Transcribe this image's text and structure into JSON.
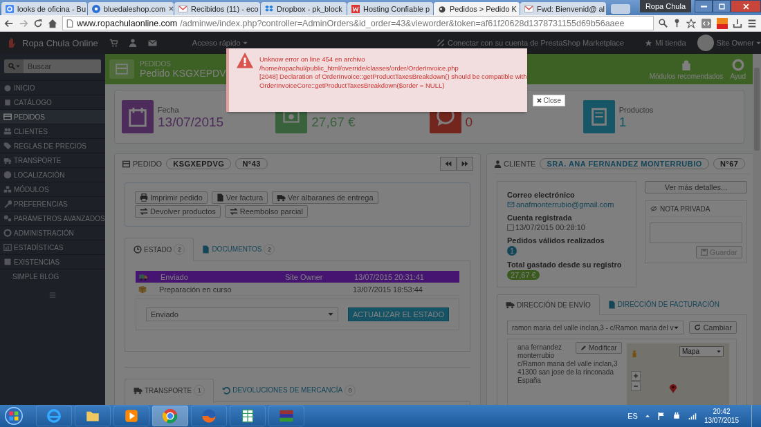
{
  "browser": {
    "tabs": [
      {
        "title": "looks de oficina - Bu",
        "kind": "google",
        "selected": false
      },
      {
        "title": "bluedaleshop.com",
        "kind": "a",
        "selected": false
      },
      {
        "title": "Recibidos (11) - eco",
        "kind": "mail",
        "selected": false
      },
      {
        "title": "Dropbox - pk_block",
        "kind": "dropbox",
        "selected": false
      },
      {
        "title": "Hosting Confiable p",
        "kind": "hosting",
        "selected": false
      },
      {
        "title": "Pedidos > Pedido K",
        "kind": "shop",
        "selected": true
      },
      {
        "title": "Fwd: Bienvenid@ al",
        "kind": "mail",
        "selected": false
      }
    ],
    "profile": "Ropa Chula",
    "url_host": "www.ropachulaonline.com",
    "url_path": "/adminwe/index.php?controller=AdminOrders&id_order=43&vieworder&token=af61f20628d1378731155d69b56aaee"
  },
  "admin_header": {
    "shop_name": "Ropa Chula Online",
    "quick_access": "Acceso rápido",
    "marketplace": "Conectar con su cuenta de PrestaShop Marketplace",
    "my_shop": "Mi tienda",
    "user": "Site Owner"
  },
  "sidebar": {
    "search_placeholder": "Buscar",
    "items": [
      {
        "label": "INICIO",
        "selected": false
      },
      {
        "label": "CATÁLOGO",
        "selected": false
      },
      {
        "label": "PEDIDOS",
        "selected": true
      },
      {
        "label": "CLIENTES",
        "selected": false
      },
      {
        "label": "REGLAS DE PRECIOS",
        "selected": false
      },
      {
        "label": "TRANSPORTE",
        "selected": false
      },
      {
        "label": "LOCALIZACIÓN",
        "selected": false
      },
      {
        "label": "MÓDULOS",
        "selected": false
      },
      {
        "label": "PREFERENCIAS",
        "selected": false
      },
      {
        "label": "PARÁMETROS AVANZADOS",
        "selected": false
      },
      {
        "label": "ADMINISTRACIÓN",
        "selected": false
      },
      {
        "label": "ESTADÍSTICAS",
        "selected": false
      },
      {
        "label": "EXISTENCIAS",
        "selected": false
      },
      {
        "label": "SIMPLE BLOG",
        "selected": false
      }
    ]
  },
  "page_header": {
    "breadcrumb": "PEDIDOS",
    "title": "Pedido KSGXEPDV",
    "toolbar": [
      "Módulos recomendados",
      "Ayud"
    ]
  },
  "kpis": [
    {
      "kind": "date",
      "label": "Fecha",
      "value": "13/07/2015"
    },
    {
      "kind": "money",
      "value": "27,67 €"
    },
    {
      "kind": "messages",
      "value": "0"
    },
    {
      "kind": "products",
      "label": "Productos",
      "value": "1"
    }
  ],
  "order": {
    "heading": "PEDIDO",
    "reference": "KSGXEPDVG",
    "number": "N°43",
    "actions": [
      {
        "label": "Imprimir pedido",
        "kind": "print"
      },
      {
        "label": "Ver factura",
        "kind": "file"
      },
      {
        "label": "Ver albaranes de entrega",
        "kind": "truck"
      },
      {
        "label": "Devolver productos",
        "kind": "exchange"
      },
      {
        "label": "Reembolso parcial",
        "kind": "exchange"
      }
    ],
    "tabs": [
      {
        "label": "ESTADO",
        "count": "2",
        "kind": "clock",
        "selected": true
      },
      {
        "label": "DOCUMENTOS",
        "count": "2",
        "kind": "file",
        "selected": false
      }
    ],
    "history": [
      {
        "kind": "shipped",
        "status": "Enviado",
        "employee": "Site Owner",
        "date": "13/07/2015 20:31:41",
        "highlighted": true
      },
      {
        "kind": "preparing",
        "status": "Preparación en curso",
        "date": "13/07/2015 18:53:44",
        "highlighted": false
      }
    ],
    "status_select": "Enviado",
    "update_button": "ACTUALIZAR EL ESTADO",
    "lower_tabs": [
      {
        "label": "TRANSPORTE",
        "count": "1",
        "kind": "truck",
        "selected": true
      },
      {
        "label": "DEVOLUCIONES DE MERCANCÍA",
        "count": "0",
        "kind": "undo",
        "selected": false
      }
    ]
  },
  "customer": {
    "heading": "CLIENTE",
    "name": "SRA. ANA FERNANDEZ MONTERRUBIO",
    "number": "N°67",
    "email_label": "Correo electrónico",
    "email": "anafmonterrubio@gmail.com",
    "registered_label": "Cuenta registrada",
    "registered": "13/07/2015 00:28:10",
    "orders_label": "Pedidos válidos realizados",
    "orders": "1",
    "total_label": "Total gastado desde su registro",
    "total": "27,67 €",
    "details_button": "Ver más detalles...",
    "note_heading": "NOTA PRIVADA",
    "save_button": "Guardar",
    "address_tabs": [
      {
        "label": "DIRECCIÓN DE ENVÍO",
        "kind": "truck",
        "selected": true
      },
      {
        "label": "DIRECCIÓN DE FACTURACIÓN",
        "kind": "file",
        "selected": false
      }
    ],
    "address_select": "ramon maria del valle inclan,3 - c/Ramon maria del v",
    "change_button": "Cambiar",
    "address_lines": [
      "ana fernandez",
      "monterrubio",
      "c/Ramon maria del valle inclan,3",
      "41300 san jose de la rinconada",
      "España"
    ],
    "edit_button": "Modificar",
    "map_type": "Mapa"
  },
  "error_modal": {
    "lines": [
      "Unknow error on line 454 en archivo",
      "/home/ropachul/public_html/override/classes/order/OrderInvoice.php",
      "[2048] Declaration of OrderInvoice::getProductTaxesBreakdown() should be compatible with",
      "OrderInvoiceCore::getProductTaxesBreakdown($order = NULL)"
    ],
    "close": "Close"
  },
  "taskbar": {
    "language": "ES",
    "time": "20:42",
    "date": "13/07/2015"
  }
}
